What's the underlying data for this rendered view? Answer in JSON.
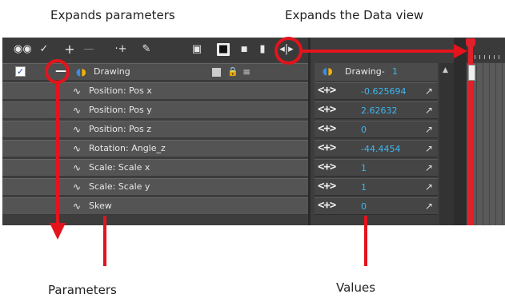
{
  "callouts": {
    "expand_params": "Expands parameters",
    "expand_data": "Expands the Data view",
    "parameters": "Parameters",
    "values": "Values"
  },
  "toolbar_icons": [
    "eye-icon",
    "animate-icon",
    "add-layer-icon",
    "remove-layer-icon",
    "add-peg-icon",
    "add-drawing-icon",
    "camera-icon",
    "layer-color-icon",
    "small-square-icon",
    "white-square-icon",
    "expand-data-view-icon"
  ],
  "layer": {
    "name": "Drawing",
    "expand_glyph": "—",
    "checked": true
  },
  "params": [
    {
      "label": "Position: Pos x",
      "value": "-0.625694"
    },
    {
      "label": "Position: Pos y",
      "value": "2.62632"
    },
    {
      "label": "Position: Pos z",
      "value": "0"
    },
    {
      "label": "Rotation: Angle_z",
      "value": "-44.4454"
    },
    {
      "label": "Scale: Scale x",
      "value": "1"
    },
    {
      "label": "Scale: Scale y",
      "value": "1"
    },
    {
      "label": "Skew",
      "value": "0"
    }
  ],
  "data_header": {
    "name": "Drawing-",
    "number": "1"
  },
  "colors": {
    "annotation": "#e3141c",
    "value_text": "#3fb6f0",
    "panel": "#3d3d3d",
    "row": "#545454"
  }
}
